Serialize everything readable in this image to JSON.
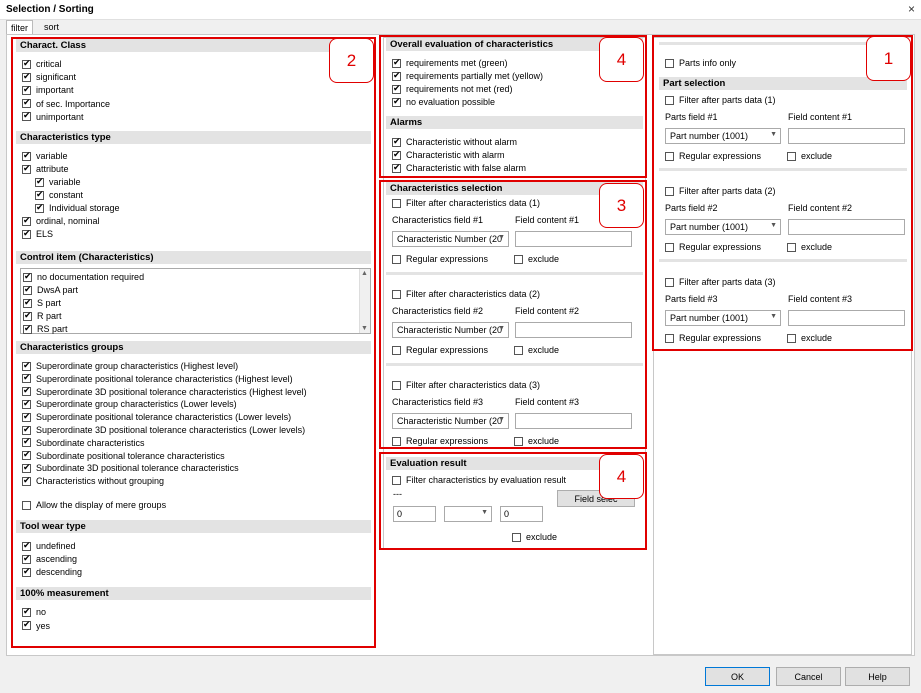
{
  "window": {
    "title": "Selection / Sorting",
    "close": "×"
  },
  "tabs": [
    "filter",
    "sort"
  ],
  "left": {
    "charact_class": {
      "title": "Charact. Class",
      "items": [
        {
          "label": "critical",
          "checked": true
        },
        {
          "label": "significant",
          "checked": true
        },
        {
          "label": "important",
          "checked": true
        },
        {
          "label": "of sec. Importance",
          "checked": true
        },
        {
          "label": "unimportant",
          "checked": true
        }
      ]
    },
    "char_type": {
      "title": "Characteristics type",
      "items": [
        {
          "label": "variable",
          "checked": true,
          "indent": 0
        },
        {
          "label": "attribute",
          "checked": true,
          "indent": 0
        },
        {
          "label": "variable",
          "checked": true,
          "indent": 1
        },
        {
          "label": "constant",
          "checked": true,
          "indent": 1
        },
        {
          "label": "Individual storage",
          "checked": true,
          "indent": 1
        },
        {
          "label": "ordinal, nominal",
          "checked": true,
          "indent": 0
        },
        {
          "label": "ELS",
          "checked": true,
          "indent": 0
        }
      ]
    },
    "control_item": {
      "title": "Control item (Characteristics)",
      "items": [
        {
          "label": "no documentation required",
          "checked": true
        },
        {
          "label": "DwsA part",
          "checked": true
        },
        {
          "label": "S part",
          "checked": true
        },
        {
          "label": "R part",
          "checked": true
        },
        {
          "label": "RS part",
          "checked": true
        }
      ]
    },
    "char_groups": {
      "title": "Characteristics groups",
      "items": [
        {
          "label": "Superordinate group characteristics (Highest level)",
          "checked": true
        },
        {
          "label": "Superordinate positional tolerance characteristics (Highest level)",
          "checked": true
        },
        {
          "label": "Superordinate 3D positional tolerance characteristics (Highest level)",
          "checked": true
        },
        {
          "label": "Superordinate group characteristics (Lower levels)",
          "checked": true
        },
        {
          "label": "Superordinate positional tolerance characteristics (Lower levels)",
          "checked": true
        },
        {
          "label": "Superordinate 3D positional tolerance characteristics (Lower levels)",
          "checked": true
        },
        {
          "label": "Subordinate characteristics",
          "checked": true
        },
        {
          "label": "Subordinate positional tolerance characteristics",
          "checked": true
        },
        {
          "label": "Subordinate 3D positional tolerance characteristics",
          "checked": true
        },
        {
          "label": "Characteristics without grouping",
          "checked": true
        }
      ],
      "extra": {
        "label": "Allow the display of mere groups",
        "checked": false
      }
    },
    "tool_wear": {
      "title": "Tool wear type",
      "items": [
        {
          "label": "undefined",
          "checked": true
        },
        {
          "label": "ascending",
          "checked": true
        },
        {
          "label": "descending",
          "checked": true
        }
      ]
    },
    "measurement": {
      "title": "100% measurement",
      "items": [
        {
          "label": "no",
          "checked": true
        },
        {
          "label": "yes",
          "checked": true
        }
      ]
    }
  },
  "middle": {
    "overall": {
      "title": "Overall evaluation of characteristics",
      "items": [
        {
          "label": "requirements met (green)",
          "checked": true
        },
        {
          "label": "requirements partially met (yellow)",
          "checked": true
        },
        {
          "label": "requirements not met (red)",
          "checked": true
        },
        {
          "label": "no evaluation possible",
          "checked": true
        }
      ]
    },
    "alarms": {
      "title": "Alarms",
      "items": [
        {
          "label": "Characteristic without alarm",
          "checked": true
        },
        {
          "label": "Characteristic with alarm",
          "checked": true
        },
        {
          "label": "Characteristic with false alarm",
          "checked": true
        }
      ]
    },
    "char_selection": {
      "title": "Characteristics selection",
      "filters": [
        {
          "filter": "Filter after characteristics data (1)",
          "field_label": "Characteristics field #1",
          "content_label": "Field content #1",
          "field_value": "Characteristic Number (20",
          "regex": "Regular expressions",
          "exclude": "exclude"
        },
        {
          "filter": "Filter after characteristics data (2)",
          "field_label": "Characteristics field #2",
          "content_label": "Field content #2",
          "field_value": "Characteristic Number (20",
          "regex": "Regular expressions",
          "exclude": "exclude"
        },
        {
          "filter": "Filter after characteristics data (3)",
          "field_label": "Characteristics field #3",
          "content_label": "Field content #3",
          "field_value": "Characteristic Number (20",
          "regex": "Regular expressions",
          "exclude": "exclude"
        }
      ]
    },
    "eval_result": {
      "title": "Evaluation result",
      "filter": "Filter characteristics by evaluation result",
      "dashes": "---",
      "field_select": "Field selec",
      "from": "0",
      "to": "0",
      "exclude": "exclude"
    }
  },
  "right": {
    "parts_info_only": "Parts info only",
    "part_selection": {
      "title": "Part selection",
      "filters": [
        {
          "filter": "Filter after parts data (1)",
          "field_label": "Parts field #1",
          "content_label": "Field content #1",
          "field_value": "Part number (1001)",
          "regex": "Regular expressions",
          "exclude": "exclude"
        },
        {
          "filter": "Filter after parts data (2)",
          "field_label": "Parts field #2",
          "content_label": "Field content #2",
          "field_value": "Part number (1001)",
          "regex": "Regular expressions",
          "exclude": "exclude"
        },
        {
          "filter": "Filter after parts data (3)",
          "field_label": "Parts field #3",
          "content_label": "Field content #3",
          "field_value": "Part number (1001)",
          "regex": "Regular expressions",
          "exclude": "exclude"
        }
      ]
    }
  },
  "badges": {
    "b1": "1",
    "b2": "2",
    "b3": "3",
    "b4a": "4",
    "b4b": "4"
  },
  "footer": {
    "ok": "OK",
    "cancel": "Cancel",
    "help": "Help"
  },
  "colors": {
    "annotation_red": "#e00000",
    "header_gray": "#e3e3e3"
  }
}
